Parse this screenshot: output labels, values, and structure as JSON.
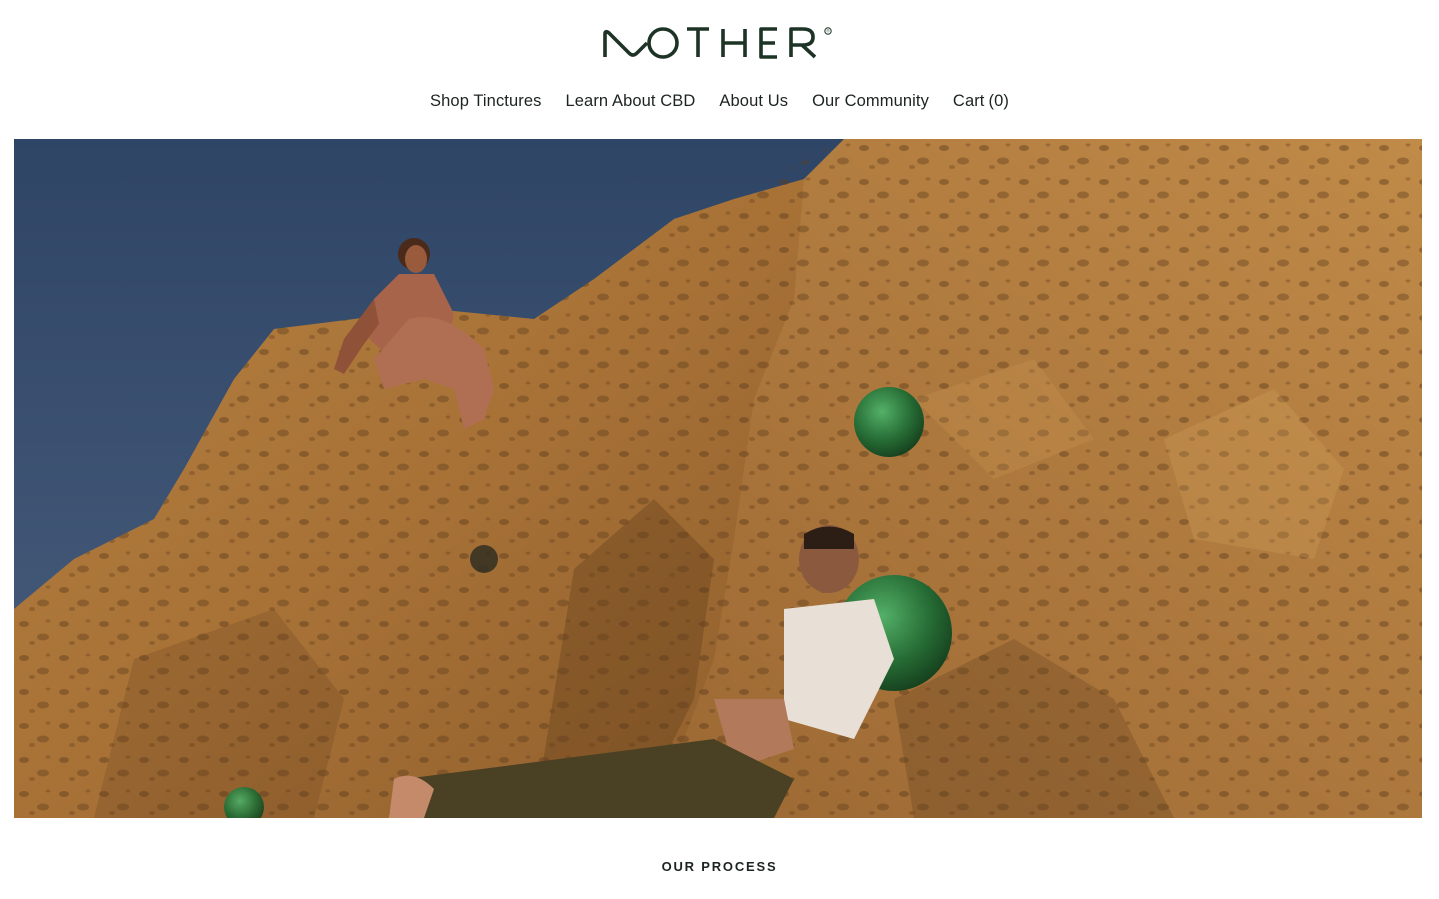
{
  "brand": {
    "name": "MOTHER",
    "registered_mark": "®",
    "color": "#1d3325"
  },
  "nav": {
    "items": [
      {
        "label": "Shop Tinctures"
      },
      {
        "label": "Learn About CBD"
      },
      {
        "label": "About Us"
      },
      {
        "label": "Our Community"
      }
    ],
    "cart": {
      "label": "Cart",
      "count": "(0)"
    }
  },
  "hero": {
    "image": "hero-photo",
    "sky_color": "#3a5172",
    "rock_color": "#b07a3e",
    "glass_color": "#1f6b34"
  },
  "section": {
    "label": "OUR PROCESS"
  }
}
